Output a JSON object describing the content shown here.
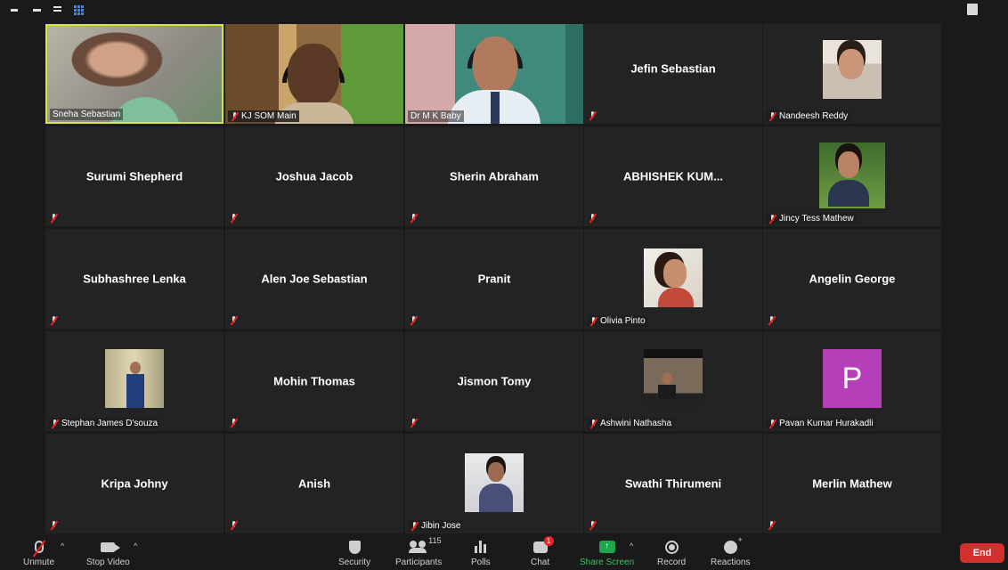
{
  "meeting": {
    "participants": [
      {
        "name": "Sneha Sebastian",
        "mode": "video",
        "muted": false,
        "active": true
      },
      {
        "name": "KJ SOM Main",
        "mode": "video",
        "muted": true
      },
      {
        "name": "Dr M K Baby",
        "mode": "video",
        "muted": false
      },
      {
        "name": "Jefin Sebastian",
        "mode": "name",
        "muted": true
      },
      {
        "name": "Nandeesh Reddy",
        "mode": "photo",
        "muted": true
      },
      {
        "name": "Surumi Shepherd",
        "mode": "name",
        "muted": true
      },
      {
        "name": "Joshua Jacob",
        "mode": "name",
        "muted": true
      },
      {
        "name": "Sherin Abraham",
        "mode": "name",
        "muted": true
      },
      {
        "name": "ABHISHEK  KUM...",
        "mode": "name",
        "muted": true
      },
      {
        "name": "Jincy Tess Mathew",
        "mode": "photo",
        "muted": true
      },
      {
        "name": "Subhashree Lenka",
        "mode": "name",
        "muted": true
      },
      {
        "name": "Alen Joe Sebastian",
        "mode": "name",
        "muted": true
      },
      {
        "name": "Pranit",
        "mode": "name",
        "muted": true
      },
      {
        "name": "Olivia Pinto",
        "mode": "photo",
        "muted": true
      },
      {
        "name": "Angelin George",
        "mode": "name",
        "muted": true
      },
      {
        "name": "Stephan James D'souza",
        "mode": "photo",
        "muted": true
      },
      {
        "name": "Mohin Thomas",
        "mode": "name",
        "muted": true
      },
      {
        "name": "Jismon Tomy",
        "mode": "name",
        "muted": true
      },
      {
        "name": "Ashwini Nathasha",
        "mode": "photo",
        "muted": true
      },
      {
        "name": "Pavan Kumar Hurakadli",
        "mode": "letter",
        "letter": "P",
        "muted": true
      },
      {
        "name": "Kripa Johny",
        "mode": "name",
        "muted": true
      },
      {
        "name": "Anish",
        "mode": "name",
        "muted": true
      },
      {
        "name": "Jibin Jose",
        "mode": "photo",
        "muted": true
      },
      {
        "name": "Swathi Thirumeni",
        "mode": "name",
        "muted": true
      },
      {
        "name": "Merlin Mathew",
        "mode": "name",
        "muted": true
      }
    ]
  },
  "toolbar": {
    "unmute": "Unmute",
    "stop_video": "Stop Video",
    "security": "Security",
    "participants": "Participants",
    "participant_count": "115",
    "polls": "Polls",
    "chat": "Chat",
    "chat_badge": "1",
    "share_screen": "Share Screen",
    "record": "Record",
    "reactions": "Reactions",
    "end": "End"
  },
  "colors": {
    "accent_active": "#d6e53a",
    "end_button": "#d22f2f",
    "share_green": "#1ea74a",
    "muted_red": "#e22222"
  }
}
